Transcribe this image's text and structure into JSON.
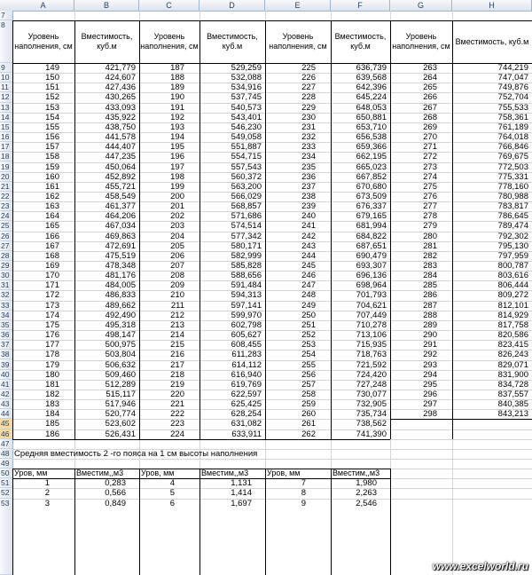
{
  "columns": [
    "A",
    "B",
    "C",
    "D",
    "E",
    "F",
    "G",
    "H"
  ],
  "rows": [
    "7",
    "8",
    "9",
    "10",
    "11",
    "12",
    "13",
    "14",
    "15",
    "16",
    "17",
    "18",
    "19",
    "20",
    "21",
    "22",
    "23",
    "24",
    "25",
    "26",
    "27",
    "28",
    "29",
    "30",
    "31",
    "32",
    "33",
    "34",
    "35",
    "36",
    "37",
    "38",
    "39",
    "40",
    "41",
    "42",
    "43",
    "44",
    "45",
    "46",
    "47",
    "48",
    "49",
    "50",
    "51",
    "52",
    "53"
  ],
  "selected_rows": [
    "45",
    "46"
  ],
  "headers": {
    "level": "Уровень наполнения, см",
    "capacity": "Вместимость, куб.м"
  },
  "table": [
    [
      [
        149,
        "421,779"
      ],
      [
        187,
        "529,259"
      ],
      [
        225,
        "636,739"
      ],
      [
        263,
        "744,219"
      ]
    ],
    [
      [
        150,
        "424,607"
      ],
      [
        188,
        "532,088"
      ],
      [
        226,
        "639,568"
      ],
      [
        264,
        "747,047"
      ]
    ],
    [
      [
        151,
        "427,436"
      ],
      [
        189,
        "534,916"
      ],
      [
        227,
        "642,396"
      ],
      [
        265,
        "749,876"
      ]
    ],
    [
      [
        152,
        "430,265"
      ],
      [
        190,
        "537,745"
      ],
      [
        228,
        "645,224"
      ],
      [
        266,
        "752,704"
      ]
    ],
    [
      [
        153,
        "433,093"
      ],
      [
        191,
        "540,573"
      ],
      [
        229,
        "648,053"
      ],
      [
        267,
        "755,533"
      ]
    ],
    [
      [
        154,
        "435,922"
      ],
      [
        192,
        "543,401"
      ],
      [
        230,
        "650,881"
      ],
      [
        268,
        "758,361"
      ]
    ],
    [
      [
        155,
        "438,750"
      ],
      [
        193,
        "546,230"
      ],
      [
        231,
        "653,710"
      ],
      [
        269,
        "761,189"
      ]
    ],
    [
      [
        156,
        "441,578"
      ],
      [
        194,
        "549,058"
      ],
      [
        232,
        "656,538"
      ],
      [
        270,
        "764,018"
      ]
    ],
    [
      [
        157,
        "444,407"
      ],
      [
        195,
        "551,887"
      ],
      [
        233,
        "659,366"
      ],
      [
        271,
        "766,846"
      ]
    ],
    [
      [
        158,
        "447,235"
      ],
      [
        196,
        "554,715"
      ],
      [
        234,
        "662,195"
      ],
      [
        272,
        "769,675"
      ]
    ],
    [
      [
        159,
        "450,064"
      ],
      [
        197,
        "557,543"
      ],
      [
        235,
        "665,023"
      ],
      [
        273,
        "772,503"
      ]
    ],
    [
      [
        160,
        "452,892"
      ],
      [
        198,
        "560,372"
      ],
      [
        236,
        "667,852"
      ],
      [
        274,
        "775,331"
      ]
    ],
    [
      [
        161,
        "455,721"
      ],
      [
        199,
        "563,200"
      ],
      [
        237,
        "670,680"
      ],
      [
        275,
        "778,160"
      ]
    ],
    [
      [
        162,
        "458,549"
      ],
      [
        200,
        "566,029"
      ],
      [
        238,
        "673,509"
      ],
      [
        276,
        "780,988"
      ]
    ],
    [
      [
        163,
        "461,377"
      ],
      [
        201,
        "568,857"
      ],
      [
        239,
        "676,337"
      ],
      [
        277,
        "783,817"
      ]
    ],
    [
      [
        164,
        "464,206"
      ],
      [
        202,
        "571,686"
      ],
      [
        240,
        "679,165"
      ],
      [
        278,
        "786,645"
      ]
    ],
    [
      [
        165,
        "467,034"
      ],
      [
        203,
        "574,514"
      ],
      [
        241,
        "681,994"
      ],
      [
        279,
        "789,474"
      ]
    ],
    [
      [
        166,
        "469,863"
      ],
      [
        204,
        "577,342"
      ],
      [
        242,
        "684,822"
      ],
      [
        280,
        "792,302"
      ]
    ],
    [
      [
        167,
        "472,691"
      ],
      [
        205,
        "580,171"
      ],
      [
        243,
        "687,651"
      ],
      [
        281,
        "795,130"
      ]
    ],
    [
      [
        168,
        "475,519"
      ],
      [
        206,
        "582,999"
      ],
      [
        244,
        "690,479"
      ],
      [
        282,
        "797,959"
      ]
    ],
    [
      [
        169,
        "478,348"
      ],
      [
        207,
        "585,828"
      ],
      [
        245,
        "693,307"
      ],
      [
        283,
        "800,787"
      ]
    ],
    [
      [
        170,
        "481,176"
      ],
      [
        208,
        "588,656"
      ],
      [
        246,
        "696,136"
      ],
      [
        284,
        "803,616"
      ]
    ],
    [
      [
        171,
        "484,005"
      ],
      [
        209,
        "591,484"
      ],
      [
        247,
        "698,964"
      ],
      [
        285,
        "806,444"
      ]
    ],
    [
      [
        172,
        "486,833"
      ],
      [
        210,
        "594,313"
      ],
      [
        248,
        "701,793"
      ],
      [
        286,
        "809,272"
      ]
    ],
    [
      [
        173,
        "489,662"
      ],
      [
        211,
        "597,141"
      ],
      [
        249,
        "704,621"
      ],
      [
        287,
        "812,101"
      ]
    ],
    [
      [
        174,
        "492,490"
      ],
      [
        212,
        "599,970"
      ],
      [
        250,
        "707,449"
      ],
      [
        288,
        "814,929"
      ]
    ],
    [
      [
        175,
        "495,318"
      ],
      [
        213,
        "602,798"
      ],
      [
        251,
        "710,278"
      ],
      [
        289,
        "817,758"
      ]
    ],
    [
      [
        176,
        "498,147"
      ],
      [
        214,
        "605,627"
      ],
      [
        252,
        "713,106"
      ],
      [
        290,
        "820,586"
      ]
    ],
    [
      [
        177,
        "500,975"
      ],
      [
        215,
        "608,455"
      ],
      [
        253,
        "715,935"
      ],
      [
        291,
        "823,415"
      ]
    ],
    [
      [
        178,
        "503,804"
      ],
      [
        216,
        "611,283"
      ],
      [
        254,
        "718,763"
      ],
      [
        292,
        "826,243"
      ]
    ],
    [
      [
        179,
        "506,632"
      ],
      [
        217,
        "614,112"
      ],
      [
        255,
        "721,592"
      ],
      [
        293,
        "829,071"
      ]
    ],
    [
      [
        180,
        "509,460"
      ],
      [
        218,
        "616,940"
      ],
      [
        256,
        "724,420"
      ],
      [
        294,
        "831,900"
      ]
    ],
    [
      [
        181,
        "512,289"
      ],
      [
        219,
        "619,769"
      ],
      [
        257,
        "727,248"
      ],
      [
        295,
        "834,728"
      ]
    ],
    [
      [
        182,
        "515,117"
      ],
      [
        220,
        "622,597"
      ],
      [
        258,
        "730,077"
      ],
      [
        296,
        "837,557"
      ]
    ],
    [
      [
        183,
        "517,946"
      ],
      [
        221,
        "625,425"
      ],
      [
        259,
        "732,905"
      ],
      [
        297,
        "840,385"
      ]
    ],
    [
      [
        184,
        "520,774"
      ],
      [
        222,
        "628,254"
      ],
      [
        260,
        "735,734"
      ],
      [
        298,
        "843,213"
      ]
    ],
    [
      [
        185,
        "523,602"
      ],
      [
        223,
        "631,082"
      ],
      [
        261,
        "738,562"
      ],
      null
    ],
    [
      [
        186,
        "526,431"
      ],
      [
        224,
        "633,911"
      ],
      [
        262,
        "741,390"
      ],
      null
    ]
  ],
  "note": "Средняя вместимость 2 -го пояса на 1 см высоты наполнения",
  "small_headers": {
    "level": "Уров, мм",
    "capacity": "Вместим,,м3"
  },
  "small_table": [
    [
      [
        1,
        "0,283"
      ],
      [
        4,
        "1,131"
      ],
      [
        7,
        "1,980"
      ]
    ],
    [
      [
        2,
        "0,566"
      ],
      [
        5,
        "1,414"
      ],
      [
        8,
        "2,263"
      ]
    ],
    [
      [
        3,
        "0,849"
      ],
      [
        6,
        "1,697"
      ],
      [
        9,
        "2,546"
      ]
    ]
  ],
  "watermark": "www.excelworld.ru"
}
